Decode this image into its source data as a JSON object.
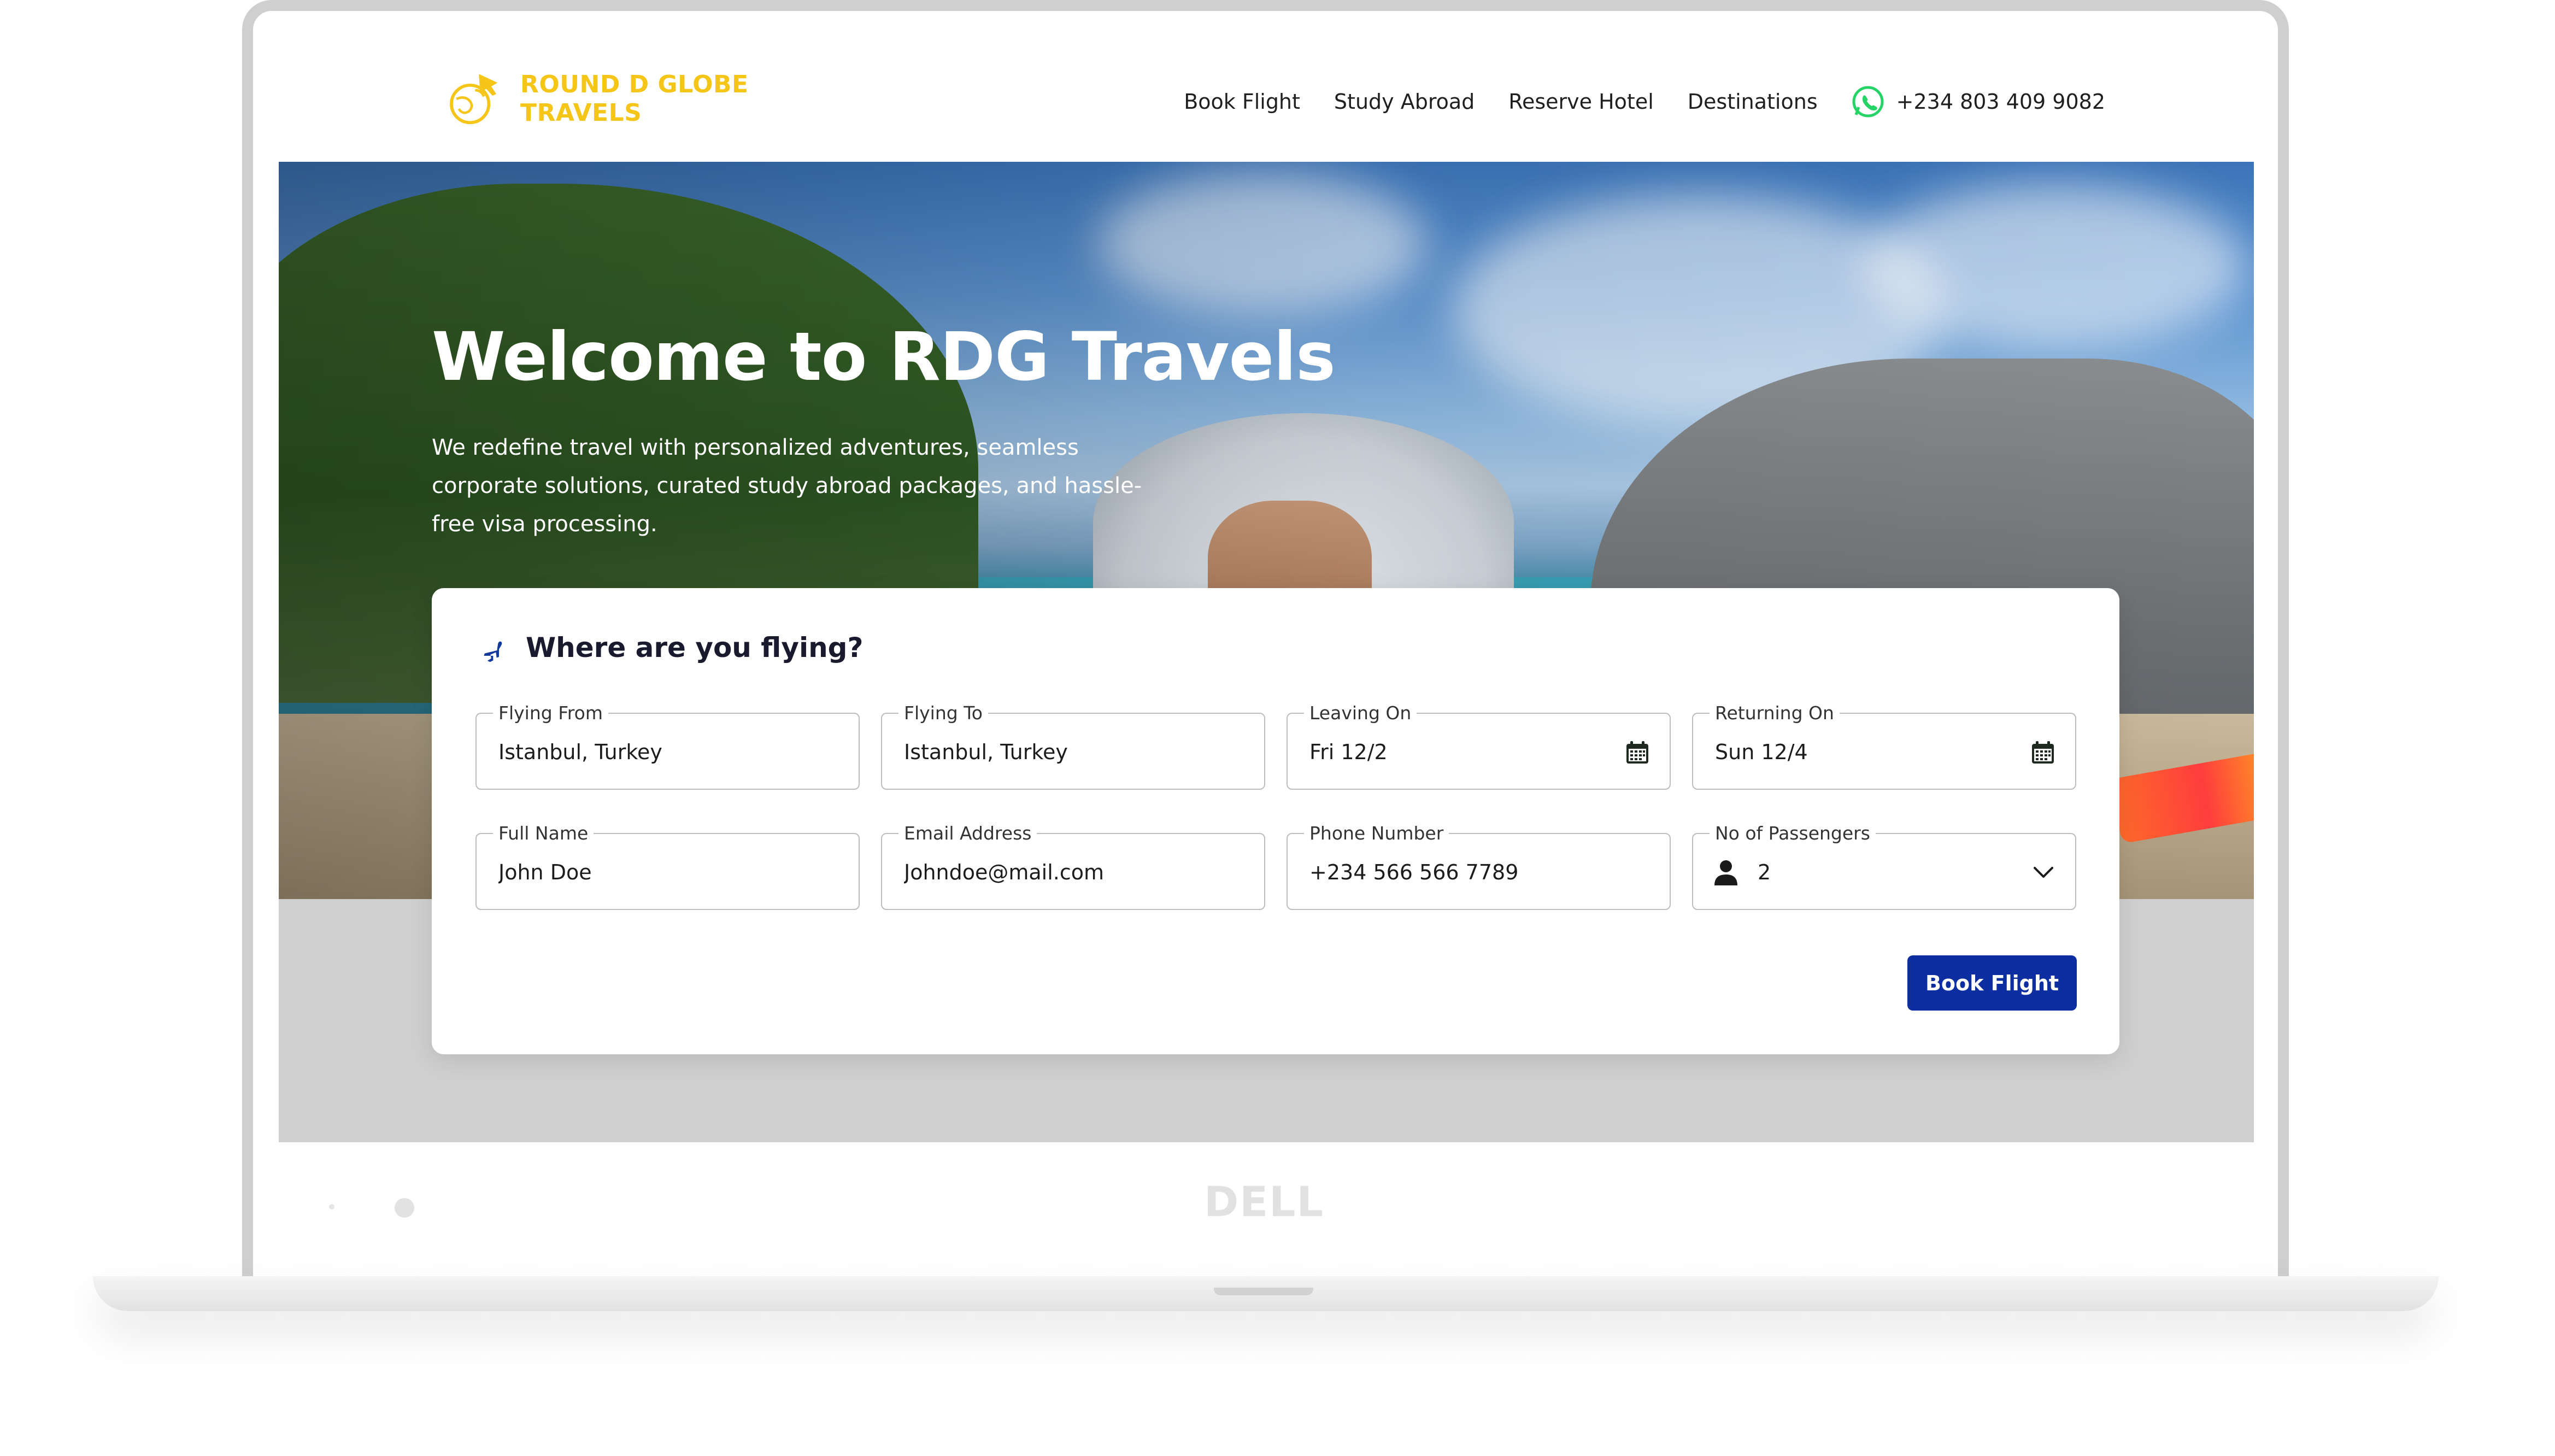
{
  "brand": {
    "name_line1": "ROUND D GLOBE",
    "name_line2": "TRAVELS",
    "accent_color": "#f5c518",
    "logo_icon": "globe-plane-icon"
  },
  "nav": {
    "items": [
      {
        "label": "Book Flight"
      },
      {
        "label": "Study Abroad"
      },
      {
        "label": "Reserve Hotel"
      },
      {
        "label": "Destinations"
      }
    ],
    "phone": "+234 803 409 9082",
    "phone_icon": "whatsapp-icon",
    "phone_icon_color": "#25d366"
  },
  "hero": {
    "title": "Welcome to RDG Travels",
    "description": "We redefine travel with personalized adventures, seamless corporate solutions, curated study abroad packages, and hassle-free visa processing."
  },
  "booking": {
    "title": "Where are you flying?",
    "title_icon": "airplane-icon",
    "fields": {
      "flying_from": {
        "label": "Flying From",
        "value": "Istanbul, Turkey"
      },
      "flying_to": {
        "label": "Flying To",
        "value": "Istanbul, Turkey"
      },
      "leaving_on": {
        "label": "Leaving On",
        "value": "Fri 12/2",
        "icon": "calendar-icon"
      },
      "returning_on": {
        "label": "Returning On",
        "value": "Sun 12/4",
        "icon": "calendar-icon"
      },
      "full_name": {
        "label": "Full Name",
        "value": "John Doe"
      },
      "email": {
        "label": "Email Address",
        "value": "Johndoe@mail.com"
      },
      "phone": {
        "label": "Phone Number",
        "value": "+234 566 566 7789"
      },
      "passengers": {
        "label": "No of Passengers",
        "value": "2",
        "icon": "user-icon"
      }
    },
    "submit_label": "Book Flight",
    "button_color": "#0d2ea0"
  },
  "device": {
    "brand": "DELL"
  }
}
